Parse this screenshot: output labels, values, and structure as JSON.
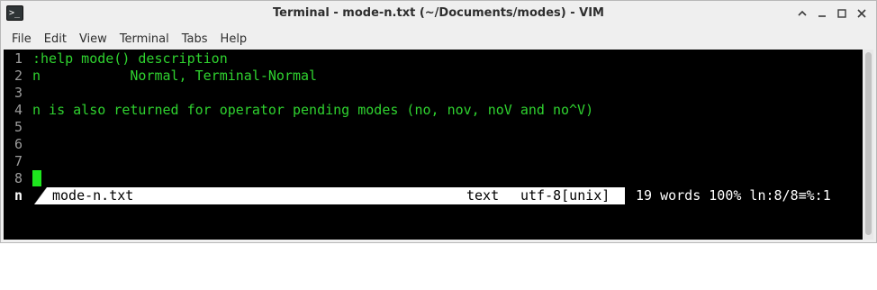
{
  "window": {
    "title": "Terminal - mode-n.txt (~/Documents/modes) - VIM",
    "icon": "terminal-icon",
    "buttons": {
      "minimize": "–",
      "maximize": "□",
      "restore": "◇",
      "close": "✕"
    }
  },
  "menubar": {
    "items": [
      "File",
      "Edit",
      "View",
      "Terminal",
      "Tabs",
      "Help"
    ]
  },
  "editor": {
    "lines": [
      {
        "num": "1",
        "text": ":help mode() description"
      },
      {
        "num": "2",
        "text": "n           Normal, Terminal-Normal"
      },
      {
        "num": "3",
        "text": ""
      },
      {
        "num": "4",
        "text": "n is also returned for operator pending modes (no, nov, noV and no^V)"
      },
      {
        "num": "5",
        "text": ""
      },
      {
        "num": "6",
        "text": ""
      },
      {
        "num": "7",
        "text": ""
      },
      {
        "num": "8",
        "text": ""
      }
    ]
  },
  "statusline": {
    "mode": "n",
    "filename": "mode-n.txt",
    "filetype": "text",
    "encoding": "utf-8[unix]",
    "info": "19 words 100% ln:8/8≡%:1"
  },
  "colors": {
    "text": "#2fd22f",
    "line_number": "#9c9c9c",
    "cursor": "#1ee61e",
    "background": "#000000"
  }
}
